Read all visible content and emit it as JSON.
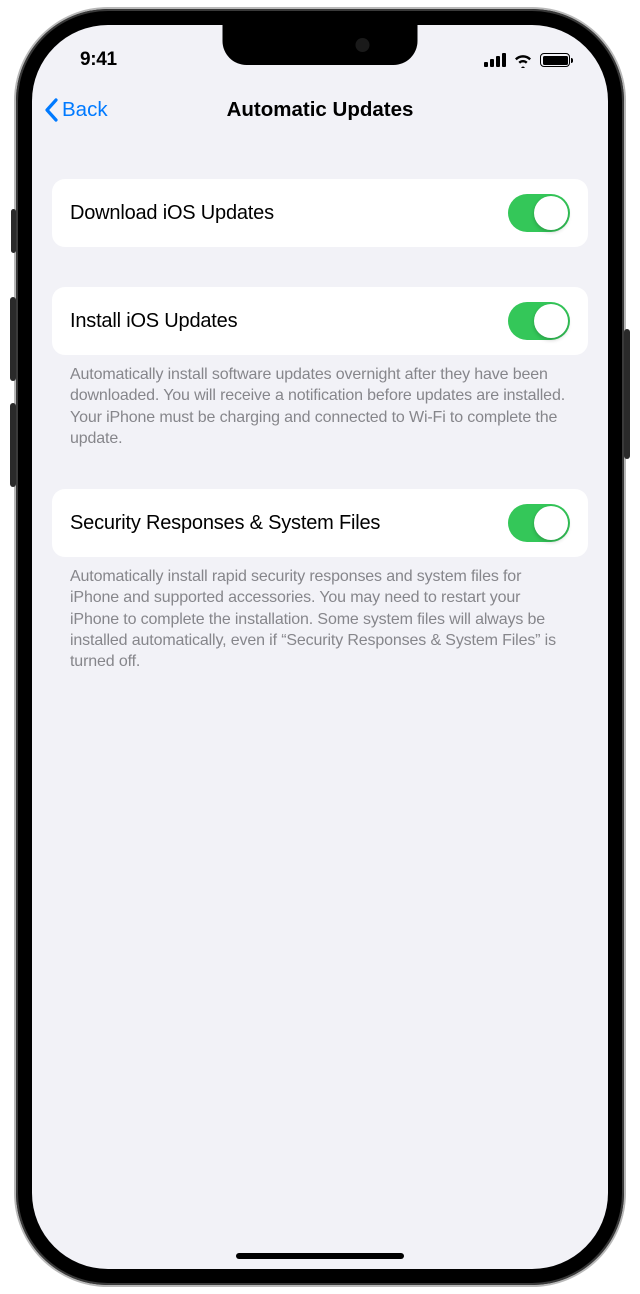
{
  "status_bar": {
    "time": "9:41"
  },
  "nav": {
    "back_label": "Back",
    "title": "Automatic Updates"
  },
  "groups": [
    {
      "label": "Download iOS Updates",
      "toggle_on": true,
      "footer": ""
    },
    {
      "label": "Install iOS Updates",
      "toggle_on": true,
      "footer": "Automatically install software updates overnight after they have been downloaded. You will receive a notification before updates are installed. Your iPhone must be charging and connected to Wi-Fi to complete the update."
    },
    {
      "label": "Security Responses & System Files",
      "toggle_on": true,
      "footer": "Automatically install rapid security responses and system files for iPhone and supported accessories. You may need to restart your iPhone to complete the installation. Some system files will always be installed automatically, even if “Security Responses & System Files” is turned off."
    }
  ]
}
